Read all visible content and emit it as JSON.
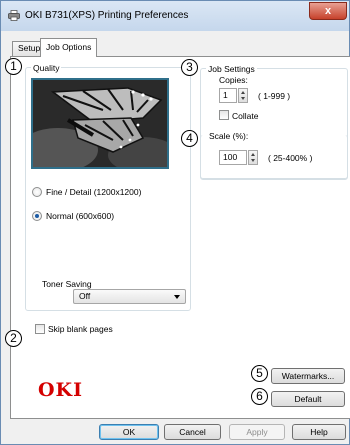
{
  "window": {
    "title": "OKI B731(XPS) Printing Preferences",
    "close_glyph": "x"
  },
  "tabs": [
    {
      "label": "Setup",
      "active": false
    },
    {
      "label": "Job Options",
      "active": true
    }
  ],
  "markers": [
    "1",
    "2",
    "3",
    "4",
    "5",
    "6"
  ],
  "quality": {
    "group_label": "Quality",
    "preview_icon": "monarch-butterfly-preview",
    "options": [
      {
        "label": "Fine / Detail (1200x1200)",
        "selected": false
      },
      {
        "label": "Normal (600x600)",
        "selected": true
      }
    ]
  },
  "toner_saving": {
    "label": "Toner Saving",
    "value": "Off"
  },
  "skip_blank": {
    "label": "Skip blank pages",
    "checked": false
  },
  "job_settings": {
    "group_label": "Job Settings",
    "copies_label": "Copies:",
    "copies_value": "1",
    "copies_range": "( 1-999 )",
    "collate_label": "Collate",
    "collate_checked": false
  },
  "scale": {
    "label": "Scale (%):",
    "value": "100",
    "range": "( 25-400% )"
  },
  "buttons": {
    "watermarks": "Watermarks...",
    "default": "Default",
    "ok": "OK",
    "cancel": "Cancel",
    "apply": "Apply",
    "help": "Help"
  },
  "brand": {
    "logo_text": "OKI",
    "color": "#d40000"
  }
}
